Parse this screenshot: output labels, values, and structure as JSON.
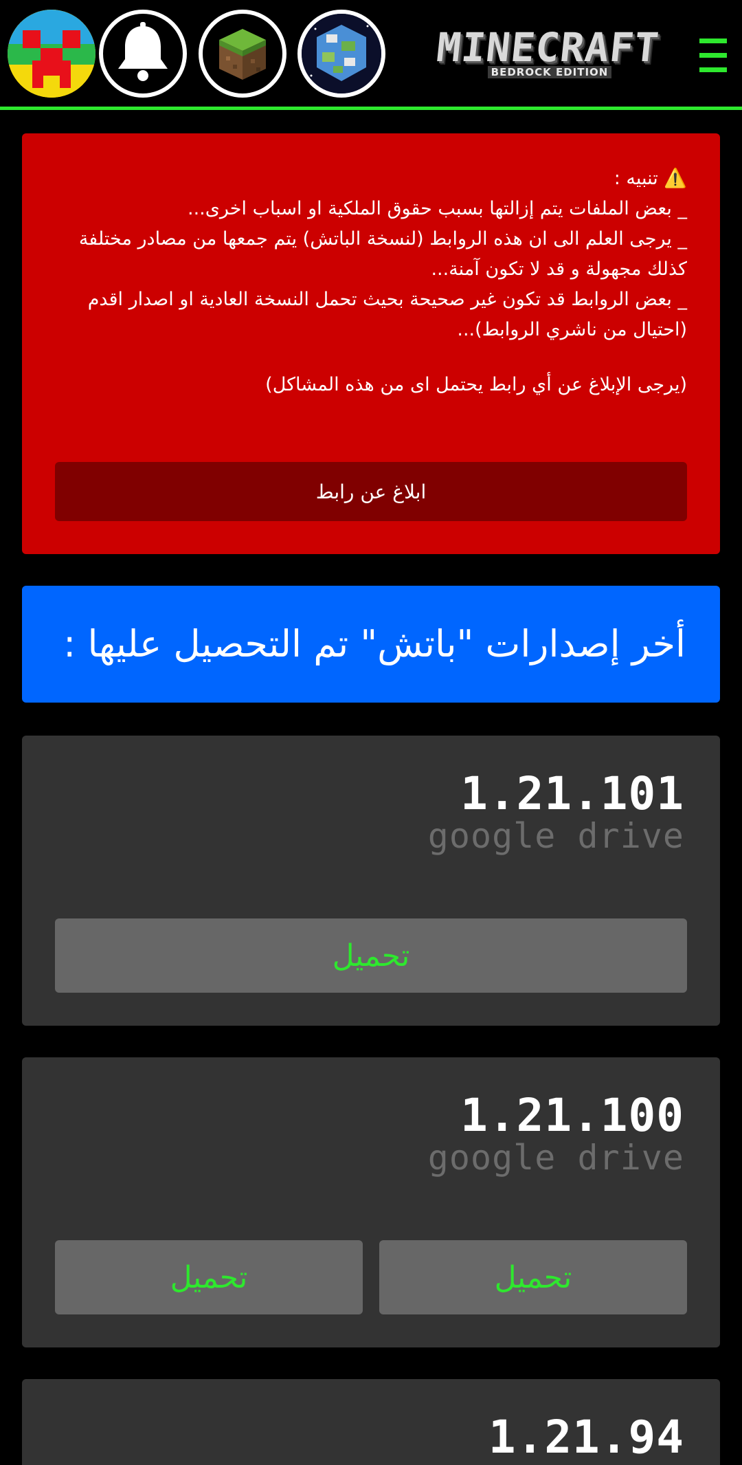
{
  "header": {
    "logo_title": "MINECRAFT",
    "logo_subtitle": "BEDROCK EDITION",
    "accent_color": "#2ee82e",
    "icons": [
      "creeper-avatar-icon",
      "bell-icon",
      "grass-block-icon",
      "earth-icon",
      "menu-icon"
    ]
  },
  "warning": {
    "bg_color": "#cc0000",
    "lines": [
      "⚠️ تنبيه :",
      "_ بعض الملفات يتم إزالتها بسبب حقوق الملكية او اسباب اخرى...",
      "_ يرجى العلم الى ان هذه الروابط (لنسخة الباتش) يتم جمعها من مصادر مختلفة كذلك مجهولة و قد لا تكون آمنة...",
      "_ بعض الروابط قد تكون غير صحيحة بحيث تحمل النسخة العادية او اصدار اقدم (احتيال من ناشري الروابط)...",
      "(يرجى الإبلاغ عن أي رابط يحتمل اى من هذه المشاكل)"
    ],
    "report_button": "ابلاغ عن رابط"
  },
  "section": {
    "title": "أخر إصدارات \"باتش\" تم التحصيل عليها :",
    "bg_color": "#0066ff"
  },
  "versions": [
    {
      "number": "1.21.101",
      "source": "google drive",
      "buttons": [
        "تحميل"
      ]
    },
    {
      "number": "1.21.100",
      "source": "google drive",
      "buttons": [
        "تحميل",
        "تحميل"
      ]
    },
    {
      "number": "1.21.94"
    }
  ]
}
